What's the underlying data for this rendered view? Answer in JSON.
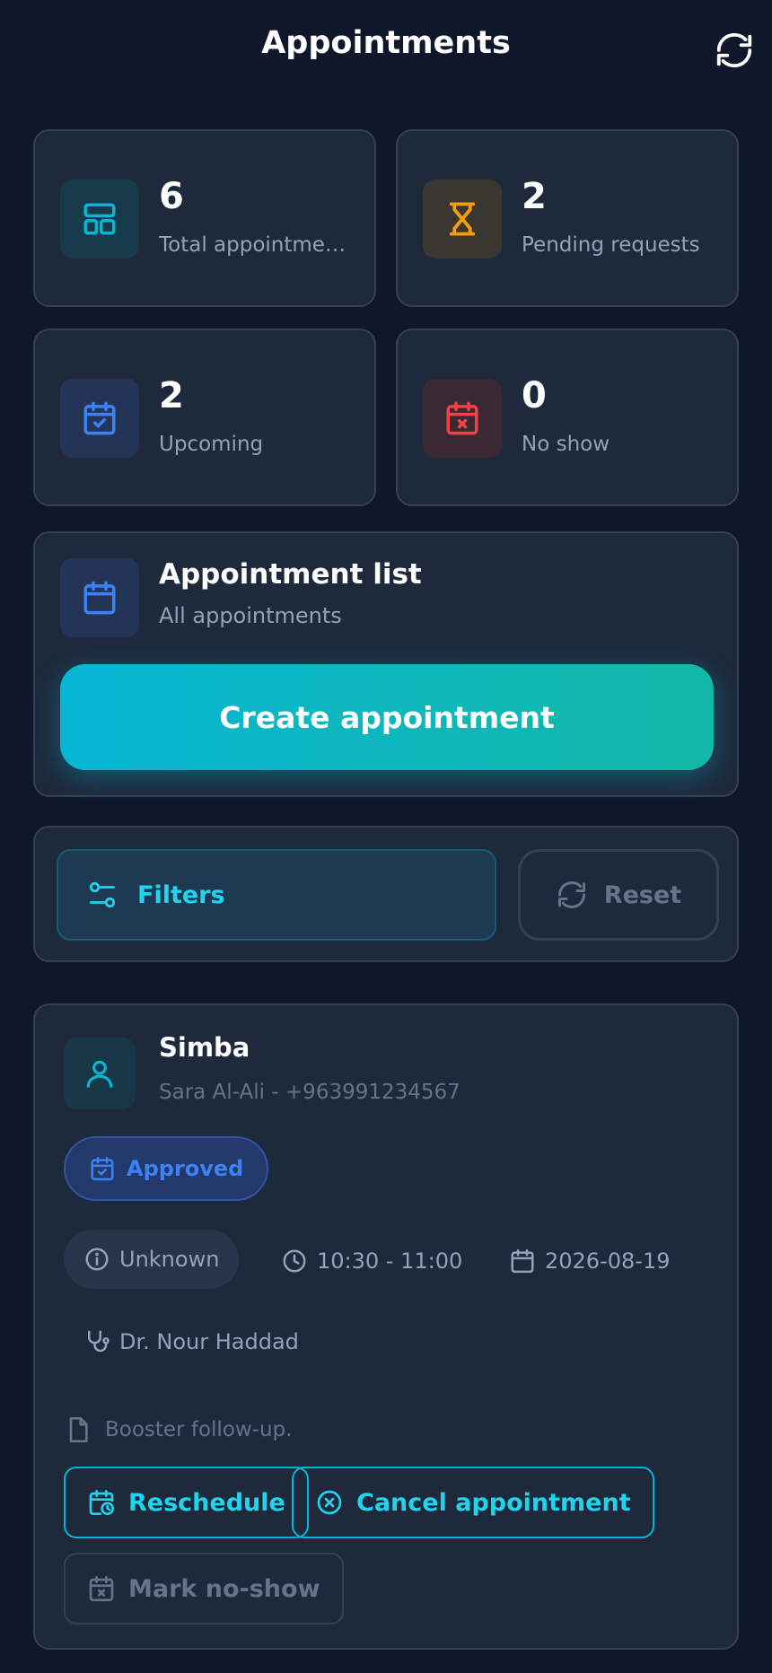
{
  "header": {
    "title": "Appointments",
    "refresh_icon": "refresh-icon"
  },
  "stats": [
    {
      "value": "6",
      "label": "Total appointments",
      "icon": "dashboard-icon",
      "color": "#06b6d4"
    },
    {
      "value": "2",
      "label": "Pending requests",
      "icon": "hourglass-icon",
      "color": "#f59e0b"
    },
    {
      "value": "2",
      "label": "Upcoming",
      "icon": "calendar-check-icon",
      "color": "#3b82f6"
    },
    {
      "value": "0",
      "label": "No show",
      "icon": "calendar-x-icon",
      "color": "#ef4444"
    }
  ],
  "appointment_list": {
    "title": "Appointment list",
    "subtitle": "All appointments",
    "create_label": "Create appointment"
  },
  "filters": {
    "filters_label": "Filters",
    "reset_label": "Reset"
  },
  "appointments": [
    {
      "pet_name": "Simba",
      "owner_line": "Sara Al-Ali - +963991234567",
      "status": "Approved",
      "type": "Unknown",
      "time": "10:30 - 11:00",
      "date": "2026-08-19",
      "doctor": "Dr. Nour Haddad",
      "note": "Booster follow-up.",
      "actions": {
        "reschedule": "Reschedule",
        "cancel": "Cancel appointment",
        "no_show": "Mark no-show"
      }
    }
  ],
  "colors": {
    "background": "#0f172a",
    "card": "#1e293b",
    "accent": "#06b6d4",
    "accent_end": "#14b8a6",
    "status_blue": "#3b82f6"
  }
}
